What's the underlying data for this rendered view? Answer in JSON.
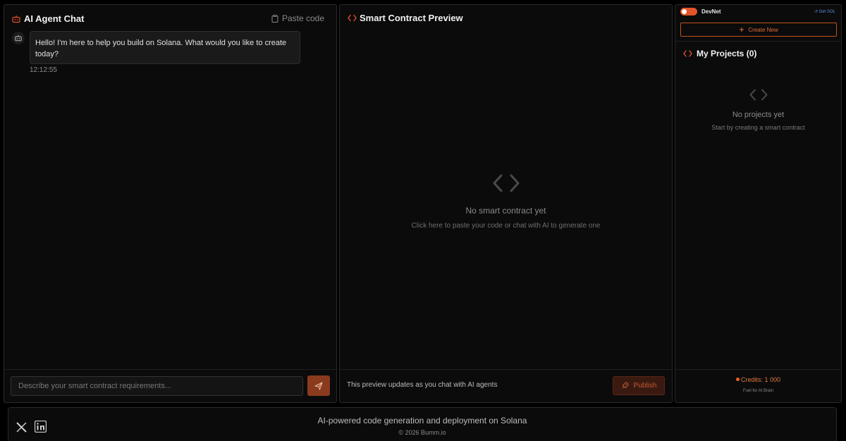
{
  "chat": {
    "title": "AI Agent Chat",
    "title_icon": "bot-icon",
    "paste_label": "Paste code",
    "paste_icon": "clipboard-icon",
    "messages": [
      {
        "sender": "bot",
        "avatar_icon": "bot-icon",
        "text": "Hello! I'm here to help you build on Solana. What would you like to create today?",
        "time": "12:12:55"
      }
    ],
    "input": {
      "placeholder": "Describe your smart contract requirements...",
      "value": ""
    },
    "send_icon": "send-icon"
  },
  "preview": {
    "title": "Smart Contract Preview",
    "title_icon": "code-icon",
    "empty_title": "No smart contract yet",
    "empty_subtitle": "Click here to paste your code or chat with AI to generate one",
    "footer_note": "This preview updates as you chat with AI agents",
    "publish_label": "Publish",
    "publish_icon": "rocket-icon"
  },
  "sidebar": {
    "network_label": "DevNet",
    "get_sol_label": "↺ Get SOL",
    "create_new_label": "Create New",
    "projects_title": "My Projects (0)",
    "empty_title": "No projects yet",
    "empty_subtitle": "Start by creating a smart contract",
    "credits_label": "Credits: 1 000",
    "credits_subtitle": "Fuel for AI Brain"
  },
  "footer": {
    "tagline": "AI-powered code generation and deployment on Solana",
    "copyright": "© 2026 Bumm.io",
    "social": [
      "x-icon",
      "linkedin-icon"
    ]
  },
  "colors": {
    "accent": "#e4542a",
    "background": "#000000",
    "panel": "#0b0b0b",
    "border": "#2a2a2a"
  }
}
